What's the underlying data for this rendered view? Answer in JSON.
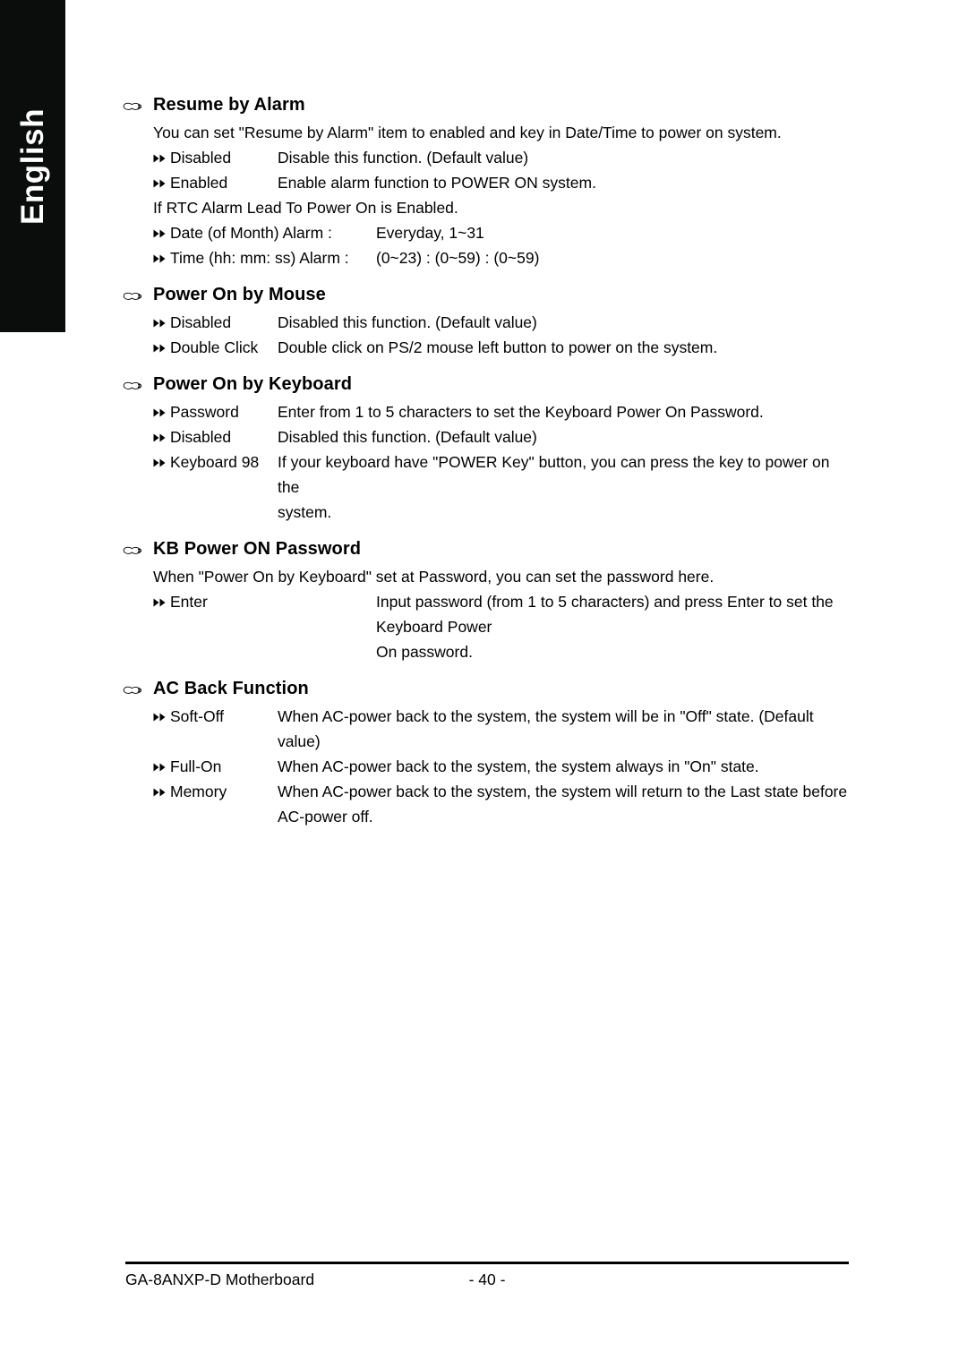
{
  "page": {
    "language_tab": "English",
    "bullet_icons": {
      "section": "pointing-hand-icon",
      "option": "double-right-arrow-icon"
    }
  },
  "sections": [
    {
      "id": "resume-by-alarm",
      "title": "Resume by Alarm",
      "intro": "You can set \"Resume by Alarm\" item to enabled and key in Date/Time to power on system.",
      "options": [
        {
          "term": "Disabled",
          "desc": "Disable this function. (Default value)"
        },
        {
          "term": "Enabled",
          "desc": "Enable alarm function to POWER ON system."
        }
      ],
      "note": "If RTC Alarm Lead To Power On is Enabled.",
      "value_options": [
        {
          "term": "Date (of Month) Alarm :",
          "desc": "Everyday, 1~31"
        },
        {
          "term": "Time (hh: mm: ss) Alarm :",
          "desc": "(0~23) : (0~59) : (0~59)"
        }
      ]
    },
    {
      "id": "power-on-by-mouse",
      "title": "Power On by Mouse",
      "options": [
        {
          "term": "Disabled",
          "desc": "Disabled this function. (Default value)"
        },
        {
          "term": "Double Click",
          "desc": "Double click on PS/2 mouse left button to power on the system."
        }
      ]
    },
    {
      "id": "power-on-by-keyboard",
      "title": "Power On by Keyboard",
      "options": [
        {
          "term": "Password",
          "desc": "Enter from 1 to 5 characters to set the Keyboard Power On Password."
        },
        {
          "term": "Disabled",
          "desc": "Disabled this function. (Default value)"
        },
        {
          "term": "Keyboard 98",
          "desc": "If your keyboard have \"POWER Key\" button, you can press the key to power on the",
          "desc_cont": "system."
        }
      ]
    },
    {
      "id": "kb-power-on-password",
      "title": "KB Power ON Password",
      "intro": "When \"Power On by Keyboard\" set at Password, you can set the password here.",
      "options": [
        {
          "term": "Enter",
          "desc": "Input password (from 1 to 5 characters) and press Enter to set the Keyboard Power",
          "desc_cont": "On password."
        }
      ]
    },
    {
      "id": "ac-back-function",
      "title": "AC Back Function",
      "options": [
        {
          "term": "Soft-Off",
          "desc": "When AC-power back to the system, the system will be in \"Off\" state. (Default value)"
        },
        {
          "term": "Full-On",
          "desc": "When AC-power back to the system, the system always in \"On\" state."
        },
        {
          "term": "Memory",
          "desc": "When AC-power back to the system, the system will return to the Last state before",
          "desc_cont": "AC-power off."
        }
      ]
    }
  ],
  "footer": {
    "left": "GA-8ANXP-D Motherboard",
    "page_number": "- 40 -"
  }
}
